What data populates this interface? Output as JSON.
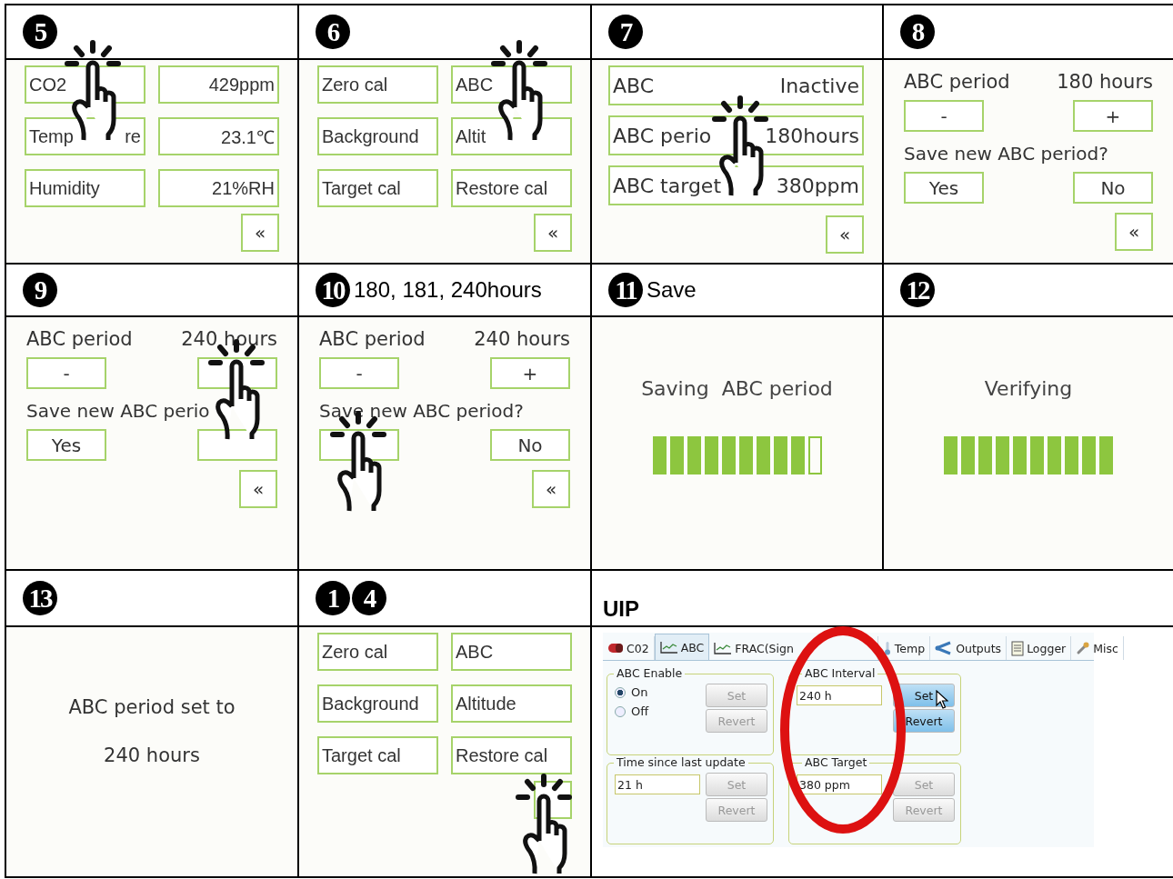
{
  "rows": [
    {
      "steps": [
        {
          "numbers": [
            "5"
          ],
          "screen": {
            "kind": "grid",
            "rows": [
              [
                {
                  "kind": "label",
                  "parts": [
                    "CO2"
                  ],
                  "tapped": true
                },
                {
                  "kind": "value",
                  "parts": [
                    "429ppm"
                  ]
                }
              ],
              [
                {
                  "kind": "label",
                  "parts": [
                    "Temp",
                    "re"
                  ]
                },
                {
                  "kind": "value",
                  "parts": [
                    "23.1℃"
                  ]
                }
              ],
              [
                {
                  "kind": "label",
                  "parts": [
                    "Humidity"
                  ]
                },
                {
                  "kind": "value",
                  "parts": [
                    "21%RH"
                  ]
                }
              ]
            ],
            "back": {
              "label": "«"
            }
          }
        },
        {
          "numbers": [
            "6"
          ],
          "screen": {
            "kind": "grid",
            "rows": [
              [
                {
                  "kind": "label",
                  "parts": [
                    "Zero cal"
                  ]
                },
                {
                  "kind": "label",
                  "parts": [
                    "ABC"
                  ],
                  "tapped": true
                }
              ],
              [
                {
                  "kind": "label",
                  "parts": [
                    "Background"
                  ]
                },
                {
                  "kind": "label",
                  "parts": [
                    "Altit"
                  ]
                }
              ],
              [
                {
                  "kind": "label",
                  "parts": [
                    "Target cal"
                  ]
                },
                {
                  "kind": "label",
                  "parts": [
                    "Restore cal"
                  ]
                }
              ]
            ],
            "back": {
              "label": "«"
            }
          }
        },
        {
          "numbers": [
            "7"
          ],
          "screen": {
            "kind": "list",
            "rows": [
              {
                "label": "ABC",
                "value": "Inactive"
              },
              {
                "label": "ABC perio",
                "value": "180hours",
                "tapped": true
              },
              {
                "label": "ABC target",
                "value": "380ppm"
              }
            ],
            "back": {
              "label": "«"
            }
          }
        },
        {
          "numbers": [
            "8"
          ],
          "screen": {
            "kind": "period",
            "label": "ABC period",
            "value": "180 hours",
            "minus": {
              "label": "-"
            },
            "plus": {
              "label": "+"
            },
            "question": "Save new ABC period?",
            "yes": {
              "label": "Yes"
            },
            "no": {
              "label": "No"
            },
            "back": {
              "label": "«"
            }
          }
        }
      ]
    },
    {
      "steps": [
        {
          "numbers": [
            "9"
          ],
          "screen": {
            "kind": "period",
            "label": "ABC period",
            "value": "240 hours",
            "minus": {
              "label": "-"
            },
            "plus": {
              "tapped": true
            },
            "question": "Save new ABC perio",
            "yes": {
              "label": "Yes"
            },
            "back": {
              "label": "«"
            }
          }
        },
        {
          "numbers": [
            "10"
          ],
          "caption": "180, 181, 240hours",
          "screen": {
            "kind": "period",
            "label": "ABC period",
            "value": "240 hours",
            "minus": {
              "label": "-"
            },
            "plus": {
              "label": "+"
            },
            "question": "Save new ABC period?",
            "yes": {
              "tapped": true
            },
            "no": {
              "label": "No"
            },
            "back": {
              "label": "«"
            }
          }
        },
        {
          "numbers": [
            "11"
          ],
          "caption": "Save",
          "screen": {
            "kind": "progress",
            "title": "Saving  ABC period",
            "level": 0.9
          }
        },
        {
          "numbers": [
            "12"
          ],
          "screen": {
            "kind": "progress",
            "title": "Verifying",
            "level": 1
          }
        }
      ]
    },
    {
      "steps": [
        {
          "numbers": [
            "13"
          ],
          "screen": {
            "kind": "message",
            "lines": [
              "ABC period set to",
              "240 hours"
            ]
          }
        },
        {
          "numbers": [
            "1",
            "4"
          ],
          "screen": {
            "kind": "grid",
            "rows": [
              [
                {
                  "kind": "label",
                  "parts": [
                    "Zero cal"
                  ]
                },
                {
                  "kind": "label",
                  "parts": [
                    "ABC"
                  ]
                }
              ],
              [
                {
                  "kind": "label",
                  "parts": [
                    "Background"
                  ]
                },
                {
                  "kind": "label",
                  "parts": [
                    "Altitude"
                  ]
                }
              ],
              [
                {
                  "kind": "label",
                  "parts": [
                    "Target cal"
                  ]
                },
                {
                  "kind": "label",
                  "parts": [
                    "Restore cal"
                  ]
                }
              ]
            ],
            "back": {
              "tapped": true
            }
          }
        },
        {
          "wide": true,
          "caption": "UIP",
          "screen": {
            "kind": "uip",
            "ring": true,
            "tabs": [
              {
                "kind": "pill",
                "label": "C02",
                "selected": false
              },
              {
                "kind": "chart",
                "label": "ABC",
                "selected": true
              },
              {
                "kind": "chart",
                "label": "FRAC(Sign",
                "selected": false
              },
              {
                "kind": "thermometer",
                "label": "Temp",
                "selected": false
              },
              {
                "kind": "share",
                "label": "Outputs",
                "selected": false
              },
              {
                "kind": "document",
                "label": "Logger",
                "selected": false
              },
              {
                "kind": "wrench",
                "label": "Misc",
                "selected": false
              }
            ],
            "groups": [
              {
                "title": "ABC Enable",
                "kind": "radio",
                "options": [
                  {
                    "label": "On",
                    "selected": true
                  },
                  {
                    "label": "Off",
                    "selected": false
                  }
                ],
                "buttons": [
                  {
                    "label": "Set",
                    "disabled": true
                  },
                  {
                    "label": "Revert",
                    "disabled": true
                  }
                ]
              },
              {
                "title": "ABC Interval",
                "kind": "field",
                "value": "240 h",
                "buttons": [
                  {
                    "label": "Set",
                    "disabled": false,
                    "pointer": true
                  },
                  {
                    "label": "Revert",
                    "disabled": false
                  }
                ]
              },
              {
                "title": "Time since last update",
                "kind": "field",
                "value": "21 h",
                "buttons": [
                  {
                    "label": "Set",
                    "disabled": true
                  },
                  {
                    "label": "Revert",
                    "disabled": true
                  }
                ]
              },
              {
                "title": "ABC Target",
                "kind": "field",
                "value": "380 ppm",
                "buttons": [
                  {
                    "label": "Set",
                    "disabled": true
                  },
                  {
                    "label": "Revert",
                    "disabled": true
                  }
                ]
              }
            ]
          }
        }
      ]
    }
  ]
}
